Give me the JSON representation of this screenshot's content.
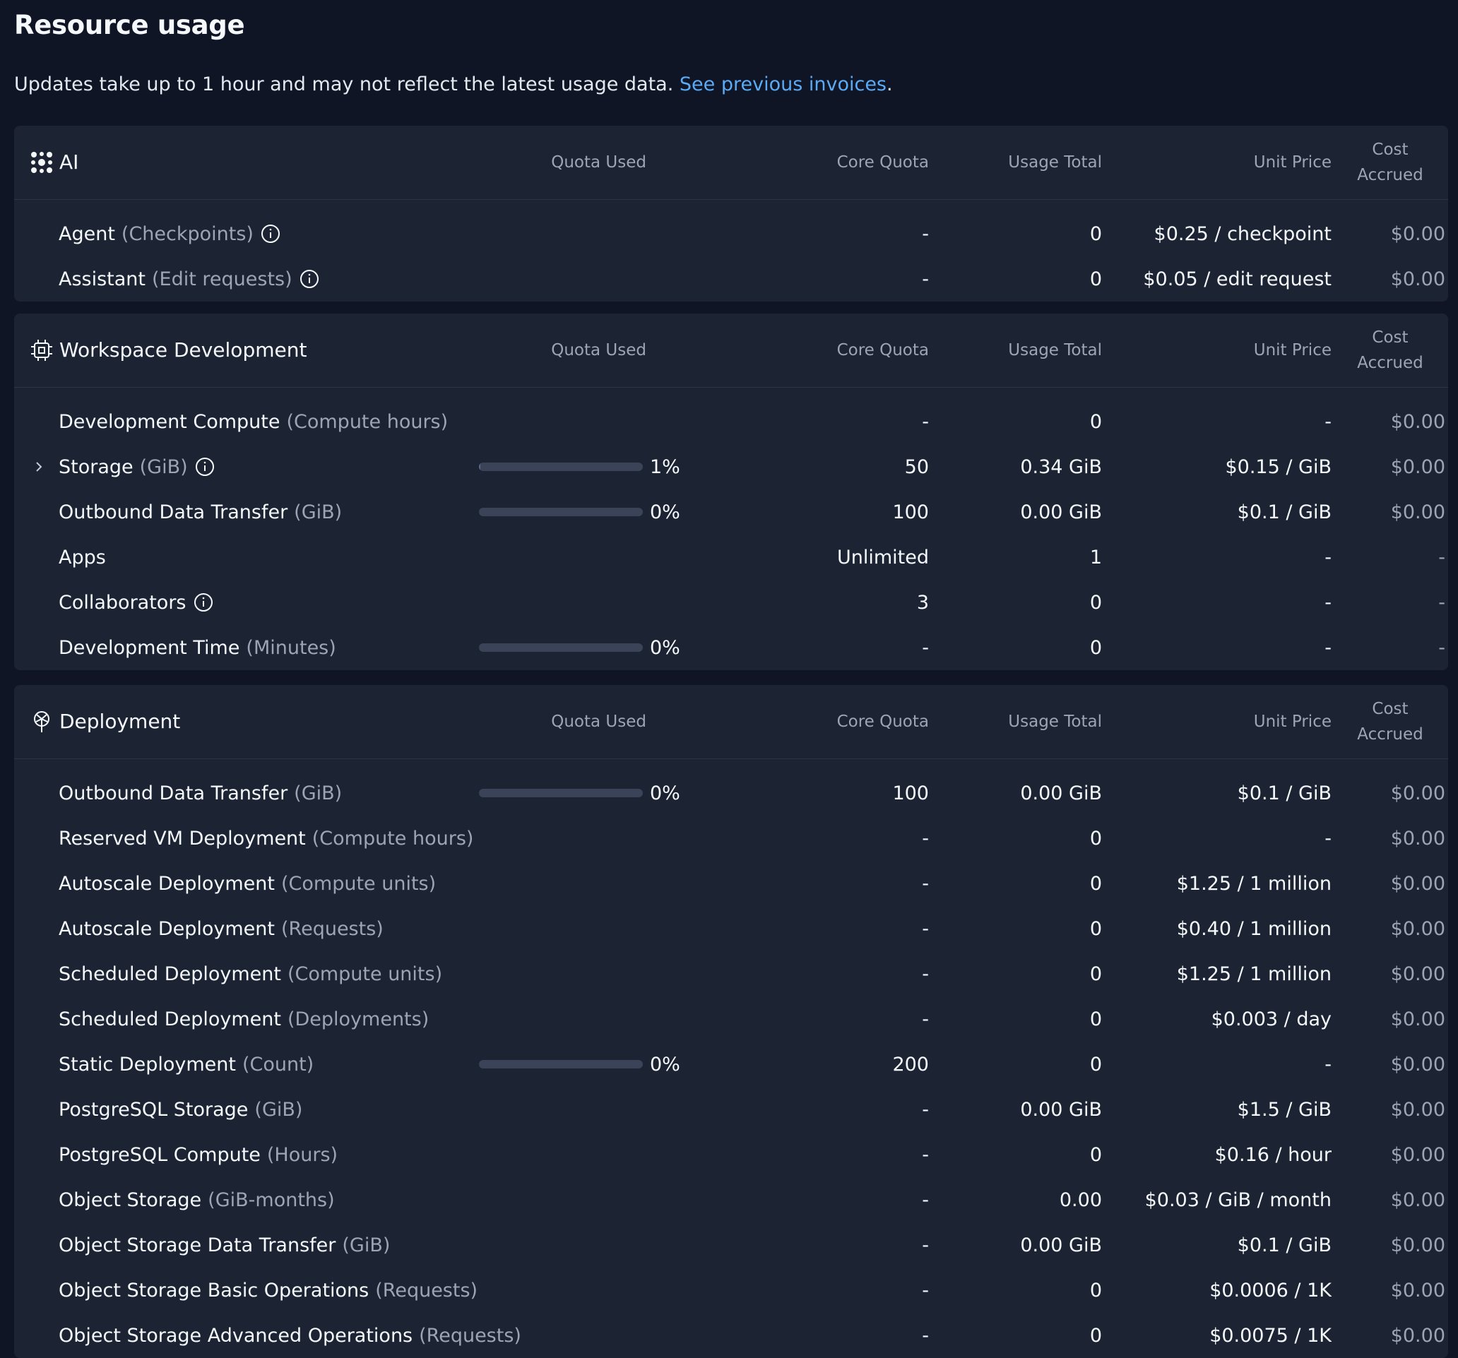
{
  "page": {
    "title": "Resource usage",
    "subtitle_text": "Updates take up to 1 hour and may not reflect the latest usage data.",
    "subtitle_link": "See previous invoices",
    "subtitle_period": "."
  },
  "columns": {
    "quota_used": "Quota Used",
    "core_quota": "Core Quota",
    "usage_total": "Usage Total",
    "unit_price": "Unit Price",
    "cost_line1": "Cost",
    "cost_line2": "Accrued"
  },
  "colors": {
    "background": "#0f1524",
    "card": "#1c2333",
    "link": "#5aaaf5",
    "muted_text": "#9da5b4"
  },
  "sections": {
    "ai": {
      "title": "AI",
      "icon": "ai-sparkle-icon",
      "rows": [
        {
          "name": "Agent",
          "unit": "(Checkpoints)",
          "info": true,
          "core": "-",
          "usage": "0",
          "price": "$0.25 / checkpoint",
          "cost": "$0.00"
        },
        {
          "name": "Assistant",
          "unit": "(Edit requests)",
          "info": true,
          "core": "-",
          "usage": "0",
          "price": "$0.05 / edit request",
          "cost": "$0.00"
        }
      ]
    },
    "workspace": {
      "title": "Workspace Development",
      "icon": "chip-icon",
      "rows": [
        {
          "name": "Development Compute",
          "unit": "(Compute hours)",
          "core": "-",
          "usage": "0",
          "price": "-",
          "cost": "$0.00"
        },
        {
          "name": "Storage",
          "unit": "(GiB)",
          "info": true,
          "expandable": true,
          "quota_pct": "1%",
          "quota_fraction": 0.01,
          "core": "50",
          "usage": "0.34 GiB",
          "price": "$0.15 / GiB",
          "cost": "$0.00"
        },
        {
          "name": "Outbound Data Transfer",
          "unit": "(GiB)",
          "quota_pct": "0%",
          "quota_fraction": 0,
          "core": "100",
          "usage": "0.00 GiB",
          "price": "$0.1 / GiB",
          "cost": "$0.00"
        },
        {
          "name": "Apps",
          "unit": "",
          "core": "Unlimited",
          "usage": "1",
          "price": "-",
          "cost": "-"
        },
        {
          "name": "Collaborators",
          "unit": "",
          "info": true,
          "core": "3",
          "usage": "0",
          "price": "-",
          "cost": "-"
        },
        {
          "name": "Development Time",
          "unit": "(Minutes)",
          "quota_pct": "0%",
          "quota_fraction": 0,
          "core": "-",
          "usage": "0",
          "price": "-",
          "cost": "-"
        }
      ]
    },
    "deployment": {
      "title": "Deployment",
      "icon": "deployment-icon",
      "rows": [
        {
          "name": "Outbound Data Transfer",
          "unit": "(GiB)",
          "quota_pct": "0%",
          "quota_fraction": 0,
          "core": "100",
          "usage": "0.00 GiB",
          "price": "$0.1 / GiB",
          "cost": "$0.00"
        },
        {
          "name": "Reserved VM Deployment",
          "unit": "(Compute hours)",
          "core": "-",
          "usage": "0",
          "price": "-",
          "cost": "$0.00"
        },
        {
          "name": "Autoscale Deployment",
          "unit": "(Compute units)",
          "core": "-",
          "usage": "0",
          "price": "$1.25 / 1 million",
          "cost": "$0.00"
        },
        {
          "name": "Autoscale Deployment",
          "unit": "(Requests)",
          "core": "-",
          "usage": "0",
          "price": "$0.40 / 1 million",
          "cost": "$0.00"
        },
        {
          "name": "Scheduled Deployment",
          "unit": "(Compute units)",
          "core": "-",
          "usage": "0",
          "price": "$1.25 / 1 million",
          "cost": "$0.00"
        },
        {
          "name": "Scheduled Deployment",
          "unit": "(Deployments)",
          "core": "-",
          "usage": "0",
          "price": "$0.003 / day",
          "cost": "$0.00"
        },
        {
          "name": "Static Deployment",
          "unit": "(Count)",
          "quota_pct": "0%",
          "quota_fraction": 0,
          "core": "200",
          "usage": "0",
          "price": "-",
          "cost": "$0.00"
        },
        {
          "name": "PostgreSQL Storage",
          "unit": "(GiB)",
          "core": "-",
          "usage": "0.00 GiB",
          "price": "$1.5 / GiB",
          "cost": "$0.00"
        },
        {
          "name": "PostgreSQL Compute",
          "unit": "(Hours)",
          "core": "-",
          "usage": "0",
          "price": "$0.16 / hour",
          "cost": "$0.00"
        },
        {
          "name": "Object Storage",
          "unit": "(GiB-months)",
          "core": "-",
          "usage": "0.00",
          "price": "$0.03 / GiB / month",
          "cost": "$0.00"
        },
        {
          "name": "Object Storage Data Transfer",
          "unit": "(GiB)",
          "core": "-",
          "usage": "0.00 GiB",
          "price": "$0.1 / GiB",
          "cost": "$0.00"
        },
        {
          "name": "Object Storage Basic Operations",
          "unit": "(Requests)",
          "core": "-",
          "usage": "0",
          "price": "$0.0006 / 1K",
          "cost": "$0.00"
        },
        {
          "name": "Object Storage Advanced Operations",
          "unit": "(Requests)",
          "core": "-",
          "usage": "0",
          "price": "$0.0075 / 1K",
          "cost": "$0.00"
        }
      ]
    }
  }
}
